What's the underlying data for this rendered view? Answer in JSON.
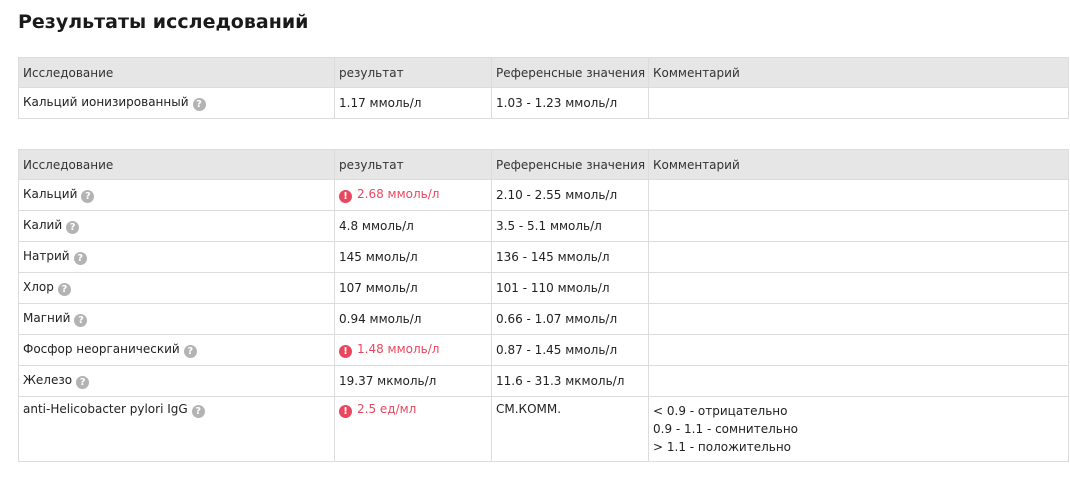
{
  "page": {
    "title": "Результаты исследований"
  },
  "columns": {
    "test": "Исследование",
    "result": "результат",
    "reference": "Референсные значения",
    "comment": "Комментарий"
  },
  "icons": {
    "help": "question-circle-icon",
    "alert": "exclamation-circle-icon"
  },
  "colors": {
    "abnormal": "#e8485f",
    "header_bg": "#e6e6e6",
    "help_icon": "#b3b3b3"
  },
  "table1": {
    "rows": [
      {
        "test": "Кальций ионизированный",
        "result": "1.17 ммоль/л",
        "reference": "1.03 - 1.23 ммоль/л",
        "comment": "",
        "abnormal": false
      }
    ]
  },
  "table2": {
    "rows": [
      {
        "test": "Кальций",
        "result": "2.68 ммоль/л",
        "reference": "2.10 - 2.55 ммоль/л",
        "comment": "",
        "abnormal": true
      },
      {
        "test": "Калий",
        "result": "4.8 ммоль/л",
        "reference": "3.5 - 5.1 ммоль/л",
        "comment": "",
        "abnormal": false
      },
      {
        "test": "Натрий",
        "result": "145 ммоль/л",
        "reference": "136 - 145 ммоль/л",
        "comment": "",
        "abnormal": false
      },
      {
        "test": "Хлор",
        "result": "107 ммоль/л",
        "reference": "101 - 110 ммоль/л",
        "comment": "",
        "abnormal": false
      },
      {
        "test": "Магний",
        "result": "0.94 ммоль/л",
        "reference": "0.66 - 1.07 ммоль/л",
        "comment": "",
        "abnormal": false
      },
      {
        "test": "Фосфор неорганический",
        "result": "1.48 ммоль/л",
        "reference": "0.87 - 1.45 ммоль/л",
        "comment": "",
        "abnormal": true
      },
      {
        "test": "Железо",
        "result": "19.37 мкмоль/л",
        "reference": "11.6 - 31.3 мкмоль/л",
        "comment": "",
        "abnormal": false
      },
      {
        "test": "anti-Helicobacter pylori IgG",
        "result": "2.5 ед/мл",
        "reference": "СМ.КОММ.",
        "comment": "",
        "abnormal": true,
        "comment_lines": [
          "< 0.9 - отрицательно",
          "0.9 - 1.1 - сомнительно",
          "> 1.1 - положительно"
        ]
      }
    ]
  }
}
